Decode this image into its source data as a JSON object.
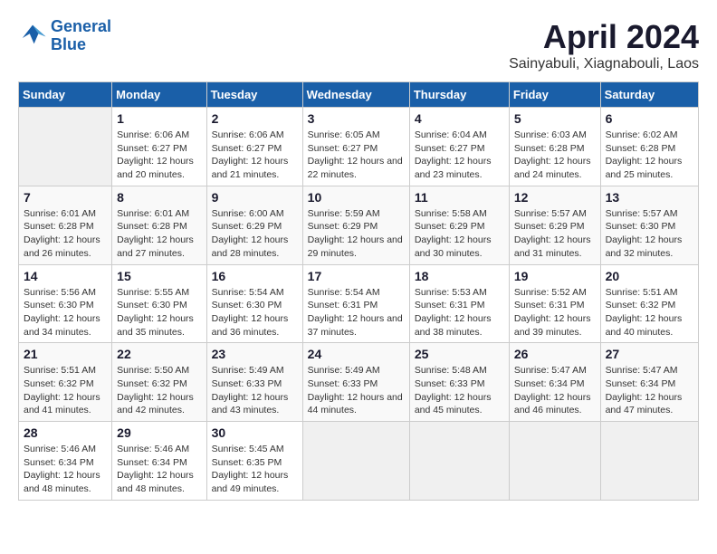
{
  "logo": {
    "line1": "General",
    "line2": "Blue"
  },
  "title": "April 2024",
  "subtitle": "Sainyabuli, Xiagnabouli, Laos",
  "days_header": [
    "Sunday",
    "Monday",
    "Tuesday",
    "Wednesday",
    "Thursday",
    "Friday",
    "Saturday"
  ],
  "weeks": [
    [
      {
        "day": "",
        "sunrise": "",
        "sunset": "",
        "daylight": ""
      },
      {
        "day": "1",
        "sunrise": "Sunrise: 6:06 AM",
        "sunset": "Sunset: 6:27 PM",
        "daylight": "Daylight: 12 hours and 20 minutes."
      },
      {
        "day": "2",
        "sunrise": "Sunrise: 6:06 AM",
        "sunset": "Sunset: 6:27 PM",
        "daylight": "Daylight: 12 hours and 21 minutes."
      },
      {
        "day": "3",
        "sunrise": "Sunrise: 6:05 AM",
        "sunset": "Sunset: 6:27 PM",
        "daylight": "Daylight: 12 hours and 22 minutes."
      },
      {
        "day": "4",
        "sunrise": "Sunrise: 6:04 AM",
        "sunset": "Sunset: 6:27 PM",
        "daylight": "Daylight: 12 hours and 23 minutes."
      },
      {
        "day": "5",
        "sunrise": "Sunrise: 6:03 AM",
        "sunset": "Sunset: 6:28 PM",
        "daylight": "Daylight: 12 hours and 24 minutes."
      },
      {
        "day": "6",
        "sunrise": "Sunrise: 6:02 AM",
        "sunset": "Sunset: 6:28 PM",
        "daylight": "Daylight: 12 hours and 25 minutes."
      }
    ],
    [
      {
        "day": "7",
        "sunrise": "Sunrise: 6:01 AM",
        "sunset": "Sunset: 6:28 PM",
        "daylight": "Daylight: 12 hours and 26 minutes."
      },
      {
        "day": "8",
        "sunrise": "Sunrise: 6:01 AM",
        "sunset": "Sunset: 6:28 PM",
        "daylight": "Daylight: 12 hours and 27 minutes."
      },
      {
        "day": "9",
        "sunrise": "Sunrise: 6:00 AM",
        "sunset": "Sunset: 6:29 PM",
        "daylight": "Daylight: 12 hours and 28 minutes."
      },
      {
        "day": "10",
        "sunrise": "Sunrise: 5:59 AM",
        "sunset": "Sunset: 6:29 PM",
        "daylight": "Daylight: 12 hours and 29 minutes."
      },
      {
        "day": "11",
        "sunrise": "Sunrise: 5:58 AM",
        "sunset": "Sunset: 6:29 PM",
        "daylight": "Daylight: 12 hours and 30 minutes."
      },
      {
        "day": "12",
        "sunrise": "Sunrise: 5:57 AM",
        "sunset": "Sunset: 6:29 PM",
        "daylight": "Daylight: 12 hours and 31 minutes."
      },
      {
        "day": "13",
        "sunrise": "Sunrise: 5:57 AM",
        "sunset": "Sunset: 6:30 PM",
        "daylight": "Daylight: 12 hours and 32 minutes."
      }
    ],
    [
      {
        "day": "14",
        "sunrise": "Sunrise: 5:56 AM",
        "sunset": "Sunset: 6:30 PM",
        "daylight": "Daylight: 12 hours and 34 minutes."
      },
      {
        "day": "15",
        "sunrise": "Sunrise: 5:55 AM",
        "sunset": "Sunset: 6:30 PM",
        "daylight": "Daylight: 12 hours and 35 minutes."
      },
      {
        "day": "16",
        "sunrise": "Sunrise: 5:54 AM",
        "sunset": "Sunset: 6:30 PM",
        "daylight": "Daylight: 12 hours and 36 minutes."
      },
      {
        "day": "17",
        "sunrise": "Sunrise: 5:54 AM",
        "sunset": "Sunset: 6:31 PM",
        "daylight": "Daylight: 12 hours and 37 minutes."
      },
      {
        "day": "18",
        "sunrise": "Sunrise: 5:53 AM",
        "sunset": "Sunset: 6:31 PM",
        "daylight": "Daylight: 12 hours and 38 minutes."
      },
      {
        "day": "19",
        "sunrise": "Sunrise: 5:52 AM",
        "sunset": "Sunset: 6:31 PM",
        "daylight": "Daylight: 12 hours and 39 minutes."
      },
      {
        "day": "20",
        "sunrise": "Sunrise: 5:51 AM",
        "sunset": "Sunset: 6:32 PM",
        "daylight": "Daylight: 12 hours and 40 minutes."
      }
    ],
    [
      {
        "day": "21",
        "sunrise": "Sunrise: 5:51 AM",
        "sunset": "Sunset: 6:32 PM",
        "daylight": "Daylight: 12 hours and 41 minutes."
      },
      {
        "day": "22",
        "sunrise": "Sunrise: 5:50 AM",
        "sunset": "Sunset: 6:32 PM",
        "daylight": "Daylight: 12 hours and 42 minutes."
      },
      {
        "day": "23",
        "sunrise": "Sunrise: 5:49 AM",
        "sunset": "Sunset: 6:33 PM",
        "daylight": "Daylight: 12 hours and 43 minutes."
      },
      {
        "day": "24",
        "sunrise": "Sunrise: 5:49 AM",
        "sunset": "Sunset: 6:33 PM",
        "daylight": "Daylight: 12 hours and 44 minutes."
      },
      {
        "day": "25",
        "sunrise": "Sunrise: 5:48 AM",
        "sunset": "Sunset: 6:33 PM",
        "daylight": "Daylight: 12 hours and 45 minutes."
      },
      {
        "day": "26",
        "sunrise": "Sunrise: 5:47 AM",
        "sunset": "Sunset: 6:34 PM",
        "daylight": "Daylight: 12 hours and 46 minutes."
      },
      {
        "day": "27",
        "sunrise": "Sunrise: 5:47 AM",
        "sunset": "Sunset: 6:34 PM",
        "daylight": "Daylight: 12 hours and 47 minutes."
      }
    ],
    [
      {
        "day": "28",
        "sunrise": "Sunrise: 5:46 AM",
        "sunset": "Sunset: 6:34 PM",
        "daylight": "Daylight: 12 hours and 48 minutes."
      },
      {
        "day": "29",
        "sunrise": "Sunrise: 5:46 AM",
        "sunset": "Sunset: 6:34 PM",
        "daylight": "Daylight: 12 hours and 48 minutes."
      },
      {
        "day": "30",
        "sunrise": "Sunrise: 5:45 AM",
        "sunset": "Sunset: 6:35 PM",
        "daylight": "Daylight: 12 hours and 49 minutes."
      },
      {
        "day": "",
        "sunrise": "",
        "sunset": "",
        "daylight": ""
      },
      {
        "day": "",
        "sunrise": "",
        "sunset": "",
        "daylight": ""
      },
      {
        "day": "",
        "sunrise": "",
        "sunset": "",
        "daylight": ""
      },
      {
        "day": "",
        "sunrise": "",
        "sunset": "",
        "daylight": ""
      }
    ]
  ]
}
